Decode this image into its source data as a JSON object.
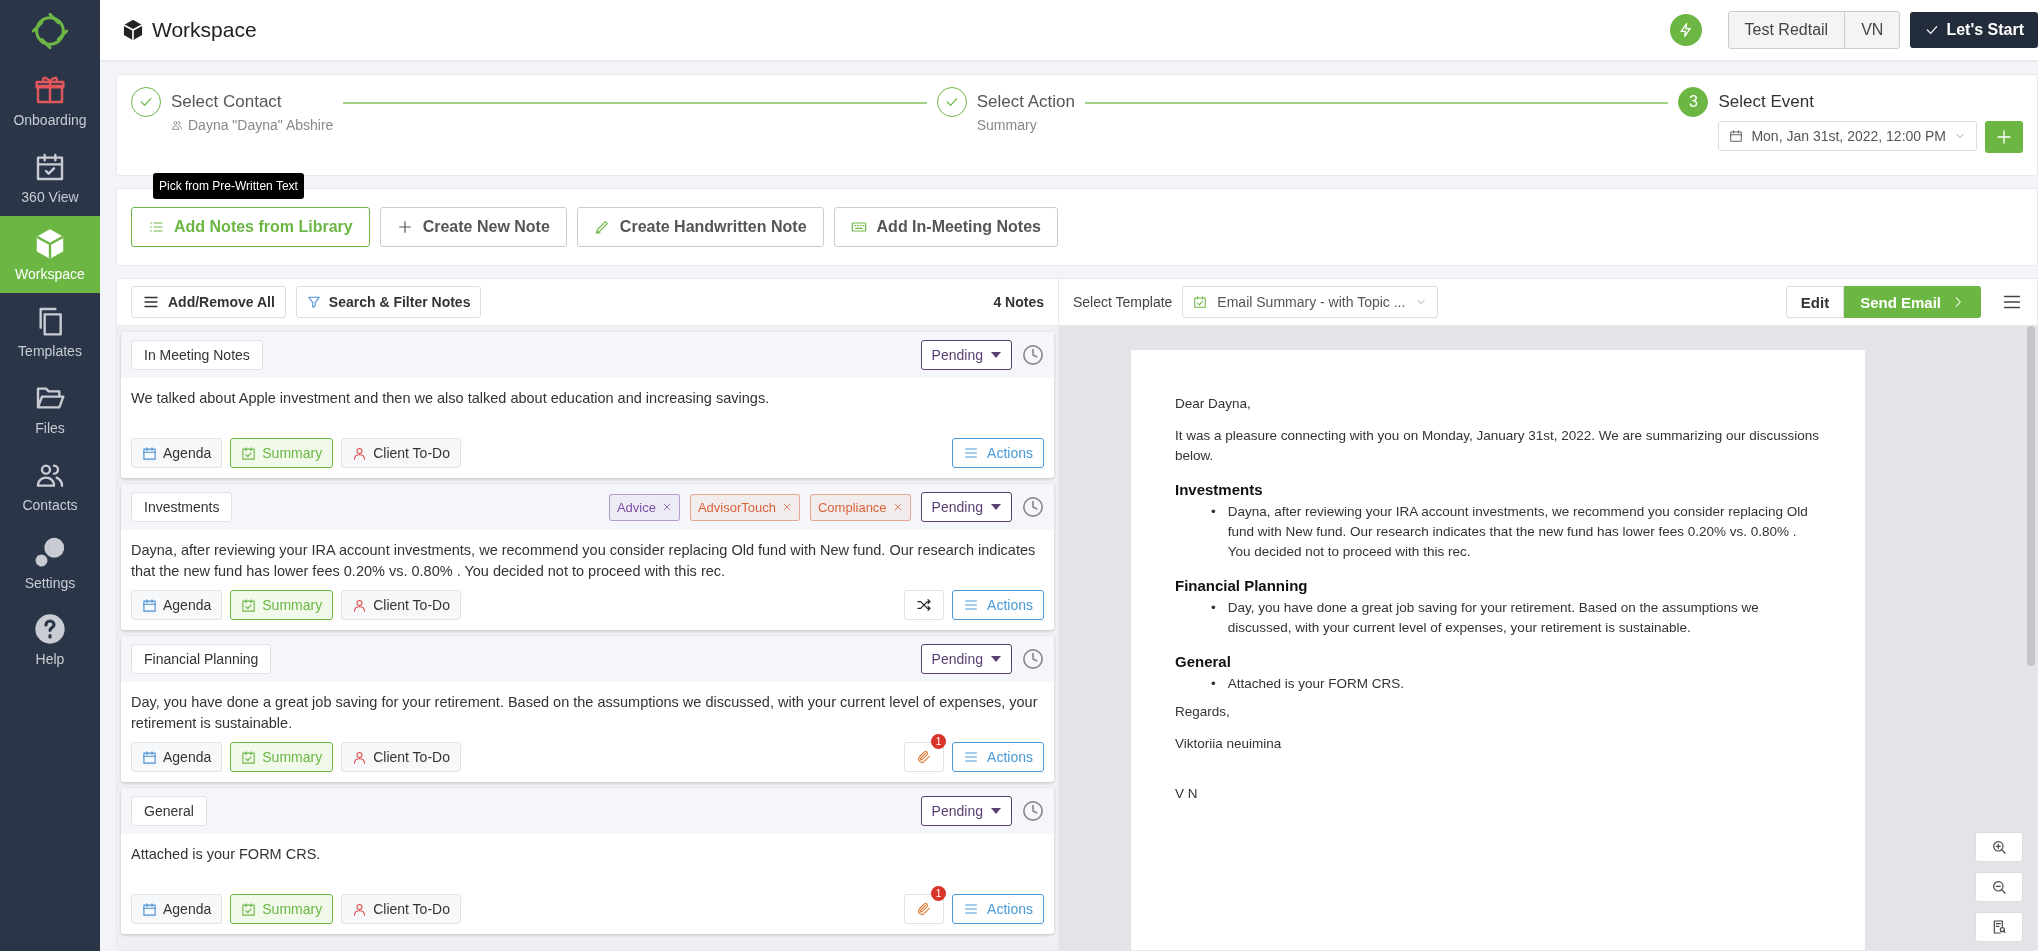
{
  "sidebar": {
    "items": [
      {
        "label": "Onboarding",
        "kind": "gift",
        "selected": false
      },
      {
        "label": "360 View",
        "kind": "calendar",
        "selected": false
      },
      {
        "label": "Workspace",
        "kind": "cube",
        "selected": true
      },
      {
        "label": "Templates",
        "kind": "copy",
        "selected": false
      },
      {
        "label": "Files",
        "kind": "folder",
        "selected": false
      },
      {
        "label": "Contacts",
        "kind": "people",
        "selected": false
      },
      {
        "label": "Settings",
        "kind": "gears",
        "selected": false
      },
      {
        "label": "Help",
        "kind": "help",
        "selected": false
      }
    ]
  },
  "header": {
    "title": "Workspace",
    "account": "Test Redtail",
    "initials": "VN",
    "start_button": "Let's Start"
  },
  "stepper": {
    "steps": [
      {
        "label": "Select Contact",
        "sub": "Dayna \"Dayna\" Abshire",
        "completed": true
      },
      {
        "label": "Select Action",
        "sub": "Summary",
        "completed": true
      },
      {
        "label": "Select Event",
        "completed": false,
        "number": "3"
      }
    ],
    "event": "Mon, Jan 31st, 2022, 12:00 PM"
  },
  "tooltip": "Pick from Pre-Written Text",
  "note_buttons": [
    {
      "label": "Add Notes from Library",
      "kind": "list",
      "highlighted": true
    },
    {
      "label": "Create New Note",
      "kind": "plus",
      "highlighted": false
    },
    {
      "label": "Create Handwritten Note",
      "kind": "pen",
      "highlighted": false
    },
    {
      "label": "Add In-Meeting Notes",
      "kind": "keyboard",
      "highlighted": false
    }
  ],
  "notes_toolbar": {
    "add_remove": "Add/Remove All",
    "filter": "Search & Filter Notes",
    "count": "4 Notes"
  },
  "template": {
    "label": "Select Template",
    "value": "Email Summary - with Topic ...",
    "edit": "Edit",
    "send": "Send Email"
  },
  "notes": [
    {
      "title": "In Meeting Notes",
      "status": "Pending",
      "body": "We talked about Apple investment and then we also talked about education and increasing savings.",
      "shuffle": false,
      "categories": [
        {
          "label": "Agenda",
          "kind": "agenda",
          "selected": false
        },
        {
          "label": "Summary",
          "kind": "summary",
          "selected": true
        },
        {
          "label": "Client To-Do",
          "kind": "todo",
          "selected": false
        }
      ],
      "actions": "Actions"
    },
    {
      "title": "Investments",
      "tags": [
        {
          "label": "Advice",
          "color": "#7b4fa8"
        },
        {
          "label": "AdvisorTouch",
          "color": "#d9623a"
        },
        {
          "label": "Compliance",
          "color": "#d9623a"
        }
      ],
      "status": "Pending",
      "body": "Dayna, after reviewing your IRA account investments, we recommend you consider replacing Old fund with New fund. Our research indicates that the new fund has lower fees 0.20% vs. 0.80% . You decided not to proceed with this rec.",
      "shuffle": true,
      "categories": [
        {
          "label": "Agenda",
          "kind": "agenda",
          "selected": false
        },
        {
          "label": "Summary",
          "kind": "summary",
          "selected": true
        },
        {
          "label": "Client To-Do",
          "kind": "todo",
          "selected": false
        }
      ],
      "actions": "Actions"
    },
    {
      "title": "Financial Planning",
      "status": "Pending",
      "body": "Day, you have done a great job saving for your retirement. Based on the assumptions we discussed, with your current level of expenses, your retirement is sustainable.",
      "shuffle": false,
      "attachment_count": "1",
      "categories": [
        {
          "label": "Agenda",
          "kind": "agenda",
          "selected": false
        },
        {
          "label": "Summary",
          "kind": "summary",
          "selected": true
        },
        {
          "label": "Client To-Do",
          "kind": "todo",
          "selected": false
        }
      ],
      "actions": "Actions"
    },
    {
      "title": "General",
      "status": "Pending",
      "body": "Attached is your FORM CRS.",
      "shuffle": false,
      "attachment_count": "1",
      "categories": [
        {
          "label": "Agenda",
          "kind": "agenda",
          "selected": false
        },
        {
          "label": "Summary",
          "kind": "summary",
          "selected": true
        },
        {
          "label": "Client To-Do",
          "kind": "todo",
          "selected": false
        }
      ],
      "actions": "Actions"
    }
  ],
  "email": {
    "greeting": "Dear Dayna,",
    "intro": "It was a pleasure connecting with you on Monday, January 31st, 2022. We are summarizing our discussions below.",
    "sections": [
      {
        "heading": "Investments",
        "bullets": [
          {
            "marker": "•",
            "text": "Dayna, after reviewing your IRA account investments, we recommend you consider replacing Old fund with New fund. Our research indicates that the new fund has lower fees 0.20% vs. 0.80% . You decided not to proceed with this rec."
          }
        ]
      },
      {
        "heading": "Financial Planning",
        "bullets": [
          {
            "marker": "•",
            "text": "Day, you have done a great job saving for your retirement. Based on the assumptions we discussed, with your current level of expenses, your retirement is sustainable."
          }
        ]
      },
      {
        "heading": "General",
        "bullets": [
          {
            "marker": "•",
            "text": "Attached is your FORM CRS."
          }
        ]
      }
    ],
    "closing": "Regards,",
    "signature": "Viktoriia neuimina",
    "initials": "V N"
  }
}
